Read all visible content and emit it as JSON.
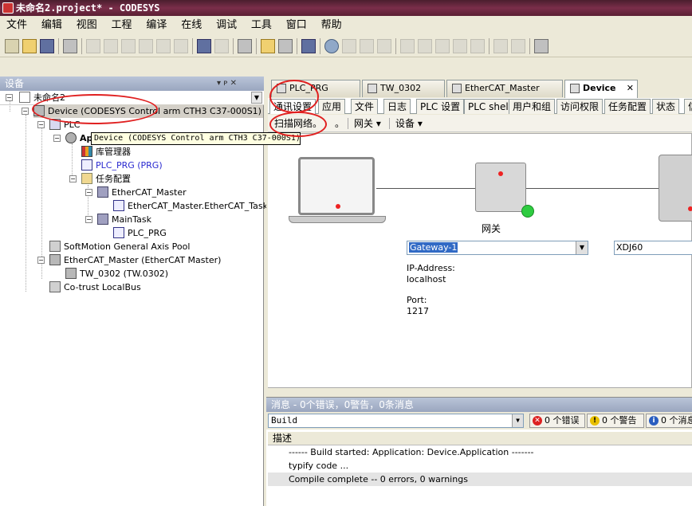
{
  "window": {
    "title": "未命名2.project* - CODESYS"
  },
  "menu": [
    "文件",
    "编辑",
    "视图",
    "工程",
    "编译",
    "在线",
    "调试",
    "工具",
    "窗口",
    "帮助"
  ],
  "devices_panel": {
    "title": "设备",
    "pin_controls": "▾ ᴘ ✕",
    "tree": {
      "project": "未命名2",
      "device": "Device (CODESYS Control arm CTH3 C37-000S1)",
      "plc": "PLC",
      "application": "Ap",
      "library_manager": "库管理器",
      "plc_prg": "PLC_PRG (PRG)",
      "task_config": "任务配置",
      "ethercat_master_task": "EtherCAT_Master",
      "ethercat_master_task_item": "EtherCAT_Master.EtherCAT_Task",
      "maintask": "MainTask",
      "maintask_item": "PLC_PRG",
      "softmotion": "SoftMotion General Axis Pool",
      "ethercat_master": "EtherCAT_Master (EtherCAT Master)",
      "tw0302": "TW_0302 (TW.0302)",
      "cotrust": "Co-trust LocalBus"
    },
    "tooltip": "Device (CODESYS Control arm CTH3 C37-000S1)"
  },
  "doc_tabs": [
    {
      "label": "PLC_PRG"
    },
    {
      "label": "TW_0302"
    },
    {
      "label": "EtherCAT_Master"
    },
    {
      "label": "Device",
      "close": "✕"
    }
  ],
  "sub_tabs": [
    "通讯设置",
    "应用",
    "文件",
    "日志",
    "PLC 设置",
    "PLC shell",
    "用户和组",
    "访问权限",
    "任务配置",
    "状态",
    "信"
  ],
  "inner_toolbar": {
    "scan": "扫描网络。",
    "dot": "。",
    "gateway": "网关 ▾",
    "device": "设备 ▾"
  },
  "comm": {
    "gateway_label": "网关",
    "gateway_select": "Gateway-1",
    "device_select": "XDJ60",
    "ip_label": "IP-Address:",
    "ip_value": "localhost",
    "port_label": "Port:",
    "port_value": "1217"
  },
  "messages": {
    "title": "消息 - 0个错误，0警告，0条消息",
    "filter": "Build",
    "errors": "0 个错误",
    "warnings": "0 个警告",
    "infos": "0 个消息",
    "column": "描述",
    "rows": [
      "------ Build started: Application: Device.Application -------",
      "typify code ...",
      "Compile complete -- 0 errors, 0 warnings"
    ]
  }
}
